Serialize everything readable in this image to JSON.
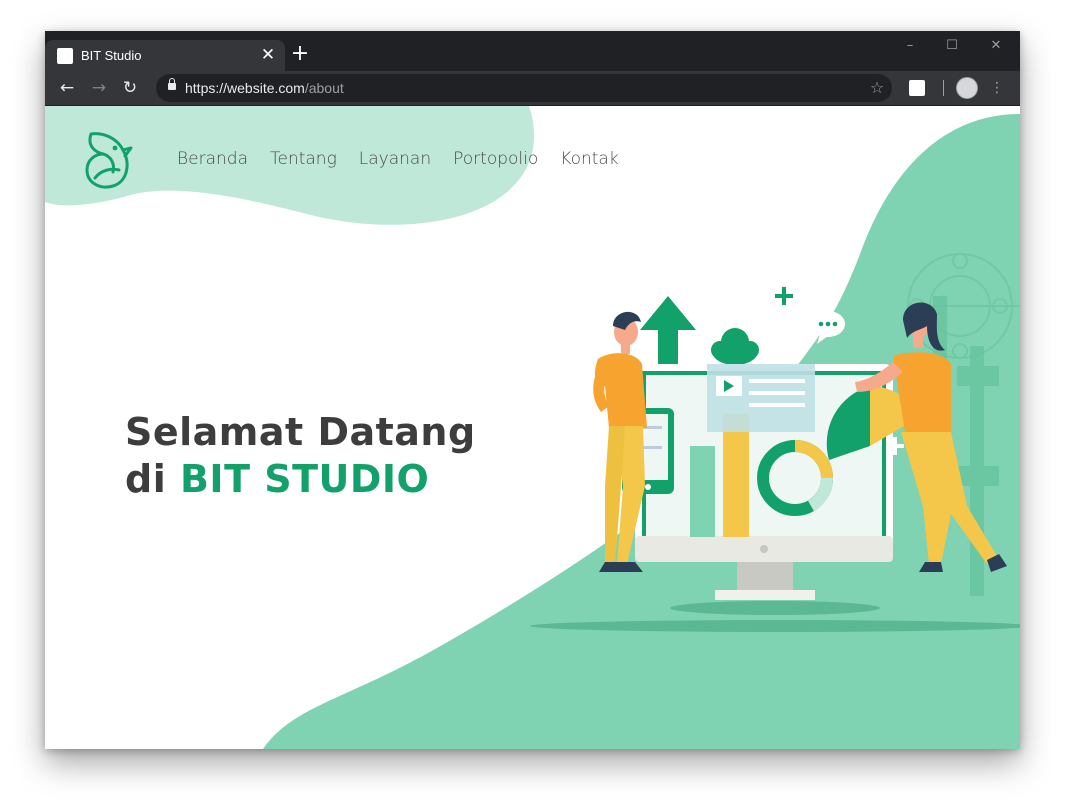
{
  "browser": {
    "tab_title": "BIT Studio",
    "tab_close": "✕",
    "new_tab": "+",
    "controls": {
      "minimize": "–",
      "maximize": "☐",
      "close": "✕"
    },
    "nav": {
      "back": "←",
      "forward": "→",
      "reload": "↻",
      "menu": "⋮",
      "star": "☆"
    },
    "url_host": "https://website.com",
    "url_path": "/about"
  },
  "page": {
    "nav_items": [
      "Beranda",
      "Tentang",
      "Layanan",
      "Portopolio",
      "Kontak"
    ],
    "hero_line1": "Selamat Datang",
    "hero_line2_prefix": "di ",
    "hero_line2_brand": "BIT STUDIO"
  },
  "colors": {
    "brand_green": "#12a16a",
    "mint": "#7fd3b2",
    "mint_light": "#bfe8d9",
    "heading": "#3d3d3d",
    "chrome_dark": "#202124",
    "chrome_tab": "#35363a"
  }
}
